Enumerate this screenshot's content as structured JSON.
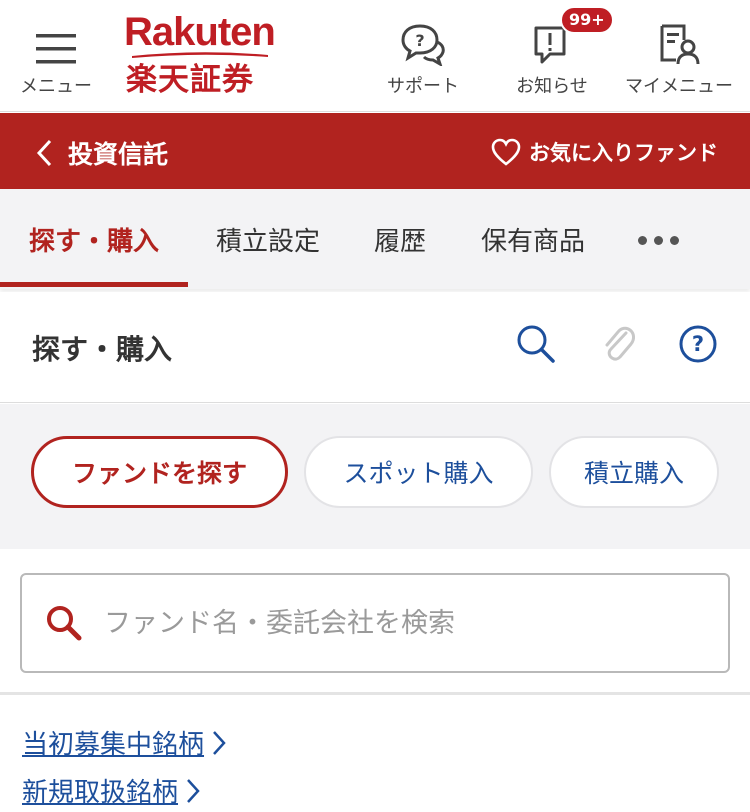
{
  "header": {
    "menu_label": "メニュー",
    "logo_en": "Rakuten",
    "logo_jp": "楽天証券",
    "support_label": "サポート",
    "news_label": "お知らせ",
    "news_badge": "99+",
    "mymenu_label": "マイメニュー"
  },
  "section_bar": {
    "title": "投資信託",
    "favorite_label": "お気に入りファンド"
  },
  "tabs": [
    {
      "label": "探す・購入",
      "active": true
    },
    {
      "label": "積立設定",
      "active": false
    },
    {
      "label": "履歴",
      "active": false
    },
    {
      "label": "保有商品",
      "active": false
    }
  ],
  "page": {
    "title": "探す・購入"
  },
  "pills": [
    {
      "label": "ファンドを探す",
      "selected": true
    },
    {
      "label": "スポット購入",
      "selected": false
    },
    {
      "label": "積立購入",
      "selected": false
    }
  ],
  "search": {
    "placeholder": "ファンド名・委託会社を検索",
    "value": ""
  },
  "links": [
    {
      "label": "当初募集中銘柄"
    },
    {
      "label": "新規取扱銘柄"
    }
  ],
  "colors": {
    "brand_red": "#b1231f",
    "link_blue": "#1d4f9c"
  },
  "icons": [
    "hamburger-icon",
    "support-chat-icon",
    "notification-icon",
    "mymenu-icon",
    "chevron-left-icon",
    "heart-icon",
    "more-icon",
    "search-icon",
    "clip-icon",
    "help-icon",
    "chevron-right-icon"
  ]
}
